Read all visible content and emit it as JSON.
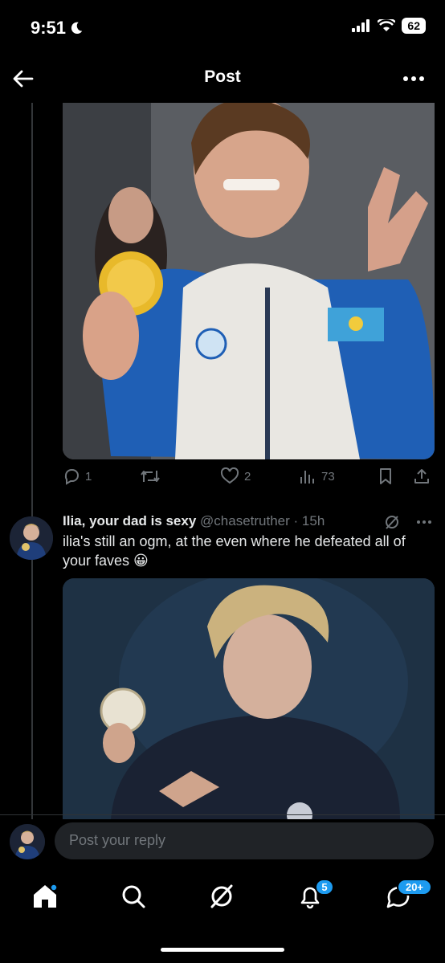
{
  "status": {
    "time": "9:51",
    "battery": "62"
  },
  "header": {
    "title": "Post"
  },
  "post_actions": {
    "replies": "1",
    "likes": "2",
    "views": "73"
  },
  "reply": {
    "name": "Ilia, your dad is sexy",
    "handle": "@chasetruther",
    "separator": " · ",
    "time": "15h",
    "text": "ilia's still an ogm, at the even where he defeated all of your faves 😀"
  },
  "compose": {
    "placeholder": "Post your reply"
  },
  "nav": {
    "notifications_badge": "5",
    "messages_badge": "20+"
  },
  "colors": {
    "background": "#000000",
    "accent": "#1d9bf0",
    "muted": "#71767b"
  }
}
